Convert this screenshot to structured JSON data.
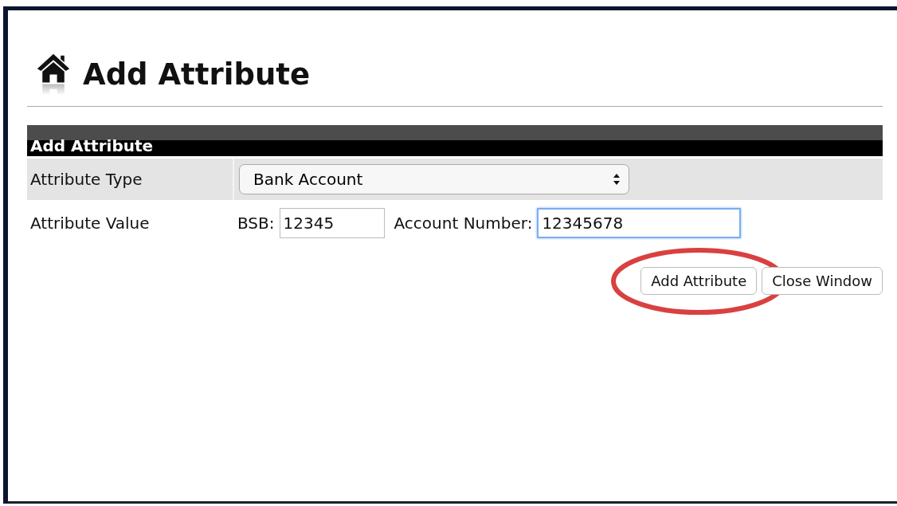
{
  "page_title": "Add Attribute",
  "section": {
    "title": "Add Attribute"
  },
  "rows": [
    {
      "kind": "select",
      "label": "Attribute Type",
      "value": "Bank Account"
    },
    {
      "kind": "fields",
      "label": "Attribute Value",
      "fields": [
        {
          "label": "BSB:",
          "value": "12345",
          "focused": false
        },
        {
          "label": "Account Number:",
          "value": "12345678",
          "focused": true
        }
      ]
    }
  ],
  "buttons": [
    {
      "label": "Add Attribute",
      "circled": true
    },
    {
      "label": "Close Window",
      "circled": false
    }
  ]
}
